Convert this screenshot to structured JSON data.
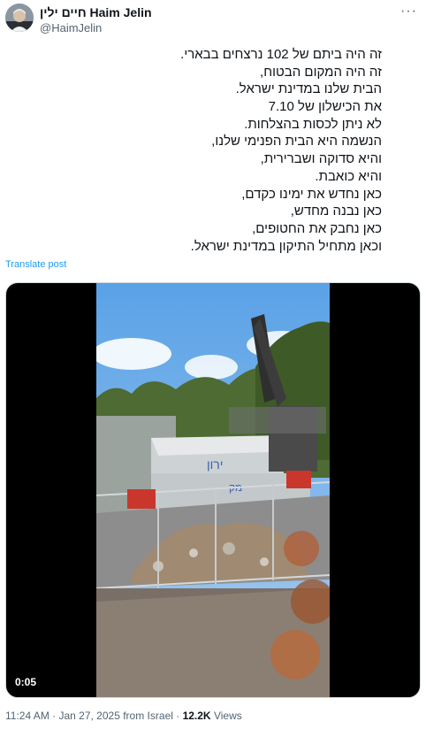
{
  "author": {
    "display_name": "חיים ילין Haim Jelin",
    "handle": "@HaimJelin",
    "avatar_icon": "avatar-photo"
  },
  "more_icon": "more-horizontal-icon",
  "post_lines": [
    "זה היה ביתם של 102 נרצחים בבארי.",
    "זה היה המקום הבטוח,",
    "הבית שלנו במדינת ישראל.",
    "את הכישלון של 7.10",
    "לא ניתן לכסות בהצלחות.",
    "הנשמה היא הבית הפנימי שלנו,",
    "והיא סדוקה ושברירית,",
    "והיא כואבת.",
    "כאן נחדש את ימינו כקדם,",
    "כאן נבנה מחדש,",
    "כאן נחבק את החטופים,",
    "וכאן מתחיל התיקון במדינת ישראל."
  ],
  "translate_label": "Translate post",
  "video": {
    "elapsed": "0:05",
    "scene": "excavator-demolition-video-frame"
  },
  "meta": {
    "time": "11:24 AM",
    "sep1": " · ",
    "date": "Jan 27, 2025",
    "source": " from Israel",
    "sep2": " · ",
    "views": "12.2K",
    "views_label": " Views"
  }
}
